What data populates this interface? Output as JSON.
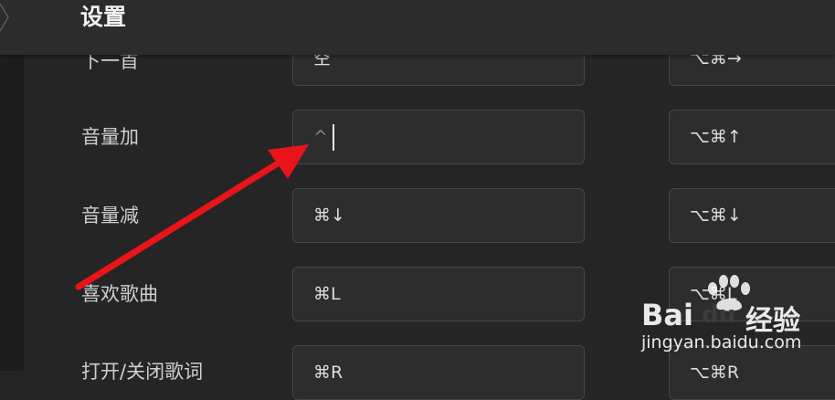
{
  "header": {
    "title": "设置"
  },
  "rows": [
    {
      "label": "下一首",
      "shortcut": "空",
      "global_shortcut": "⌥⌘→"
    },
    {
      "label": "音量加",
      "shortcut": "^",
      "global_shortcut": "⌥⌘↑"
    },
    {
      "label": "音量减",
      "shortcut": "⌘↓",
      "global_shortcut": "⌥⌘↓"
    },
    {
      "label": "喜欢歌曲",
      "shortcut": "⌘L",
      "global_shortcut": "⌥⌘L"
    },
    {
      "label": "打开/关闭歌词",
      "shortcut": "⌘R",
      "global_shortcut": "⌥⌘R"
    }
  ],
  "watermark": {
    "brand": "Bai",
    "brand_suffix": "du",
    "product": "经验",
    "url": "jingyan.baidu.com"
  },
  "colors": {
    "background": "#252525",
    "header": "#2c2c2c",
    "field": "#2d2d2d",
    "arrow": "#e8141a"
  }
}
